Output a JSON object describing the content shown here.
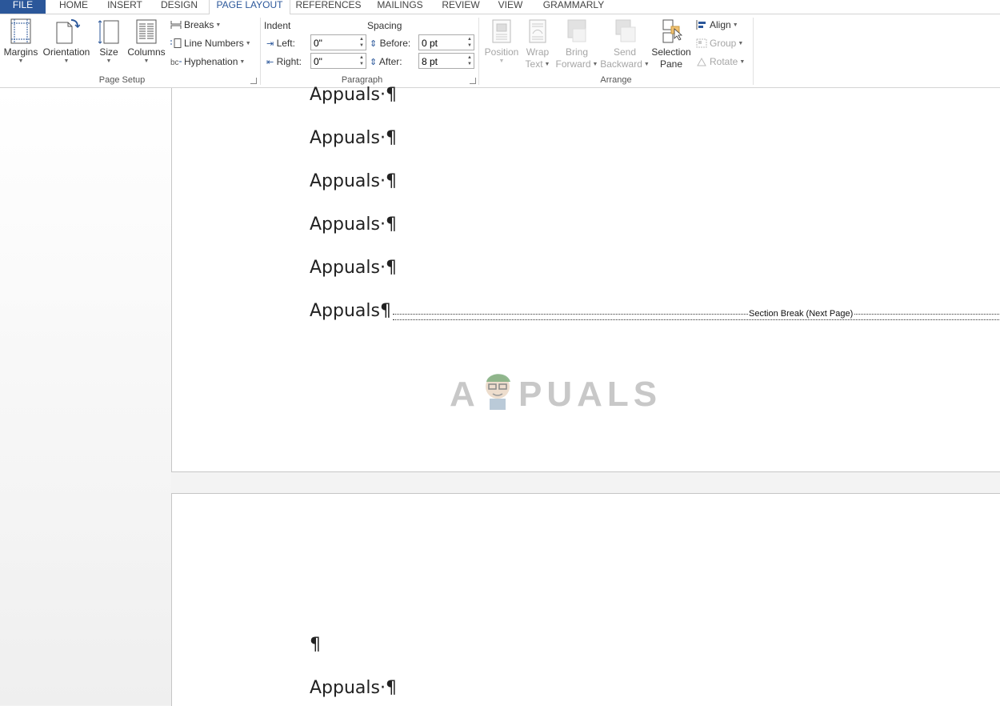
{
  "tabs": [
    {
      "label": "FILE"
    },
    {
      "label": "HOME"
    },
    {
      "label": "INSERT"
    },
    {
      "label": "DESIGN"
    },
    {
      "label": "PAGE LAYOUT"
    },
    {
      "label": "REFERENCES"
    },
    {
      "label": "MAILINGS"
    },
    {
      "label": "REVIEW"
    },
    {
      "label": "VIEW"
    },
    {
      "label": "GRAMMARLY"
    }
  ],
  "active_tab": "PAGE LAYOUT",
  "page_setup": {
    "group_label": "Page Setup",
    "margins": "Margins",
    "orientation": "Orientation",
    "size": "Size",
    "columns": "Columns",
    "breaks": "Breaks",
    "line_numbers": "Line Numbers",
    "hyphenation": "Hyphenation"
  },
  "paragraph": {
    "group_label": "Paragraph",
    "indent_label": "Indent",
    "spacing_label": "Spacing",
    "left_label": "Left:",
    "right_label": "Right:",
    "before_label": "Before:",
    "after_label": "After:",
    "left_value": "0\"",
    "right_value": "0\"",
    "before_value": "0 pt",
    "after_value": "8 pt"
  },
  "arrange": {
    "group_label": "Arrange",
    "position": "Position",
    "wrap_1": "Wrap",
    "wrap_2": "Text",
    "bring_1": "Bring",
    "bring_2": "Forward",
    "send_1": "Send",
    "send_2": "Backward",
    "selection_1": "Selection",
    "selection_2": "Pane",
    "align": "Align",
    "group": "Group",
    "rotate": "Rotate"
  },
  "document": {
    "page1_lines": [
      "Appuals·¶",
      "Appuals·¶",
      "Appuals·¶",
      "Appuals·¶",
      "Appuals·¶",
      "Appuals¶"
    ],
    "section_break": "Section Break (Next Page)",
    "watermark": "A PUALS",
    "page2_lines": [
      "¶",
      "Appuals·¶"
    ]
  },
  "colors": {
    "accent": "#2b579a",
    "disabled": "#a6a6a6"
  }
}
